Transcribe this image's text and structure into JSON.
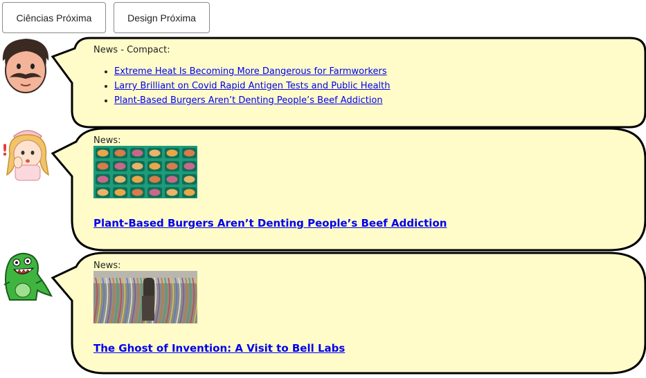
{
  "buttons": {
    "ciencias": "Ciências Próxima",
    "design": "Design Próxima"
  },
  "cards": [
    {
      "label": "News - Compact:",
      "links": [
        "Extreme Heat Is Becoming More Dangerous for Farmworkers",
        "Larry Brilliant on Covid Rapid Antigen Tests and Public Health",
        "Plant-Based Burgers Aren’t Denting People’s Beef Addiction"
      ]
    },
    {
      "label": "News:",
      "headline": "Plant-Based Burgers Aren’t Denting People’s Beef Addiction"
    },
    {
      "label": "News:",
      "headline": "The Ghost of Invention: A Visit to Bell Labs"
    }
  ],
  "colors": {
    "bubble_fill": "#fffcc9",
    "bubble_stroke": "#000000",
    "link": "#0000ee"
  }
}
